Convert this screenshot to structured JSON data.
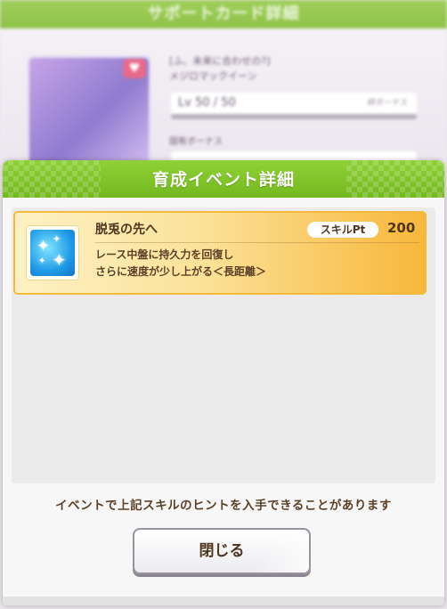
{
  "background_screen": {
    "header_title": "サポートカード詳細",
    "card_title_line1": "[ふ、未来に合わせの?]",
    "card_title_line2": "メジロマックイーン",
    "level_text": "Lv 50 / 50",
    "level_right": "絆ボーナス",
    "bonus_label": "固有ボーナス"
  },
  "modal": {
    "title": "育成イベント詳細",
    "skill": {
      "name": "脱兎の先へ",
      "pt_label": "スキルPt",
      "pt_value": "200",
      "description_line1": "レース中盤に持久力を回復し",
      "description_line2": "さらに速度が少し上がる＜長距離＞",
      "icon": "sparkle-skill-icon"
    },
    "note": "イベントで上記スキルのヒントを入手できることがあります",
    "close_label": "閉じる"
  },
  "colors": {
    "header_green": "#8fd137",
    "card_gold": "#f8b73a",
    "text_brown": "#4e3620"
  }
}
